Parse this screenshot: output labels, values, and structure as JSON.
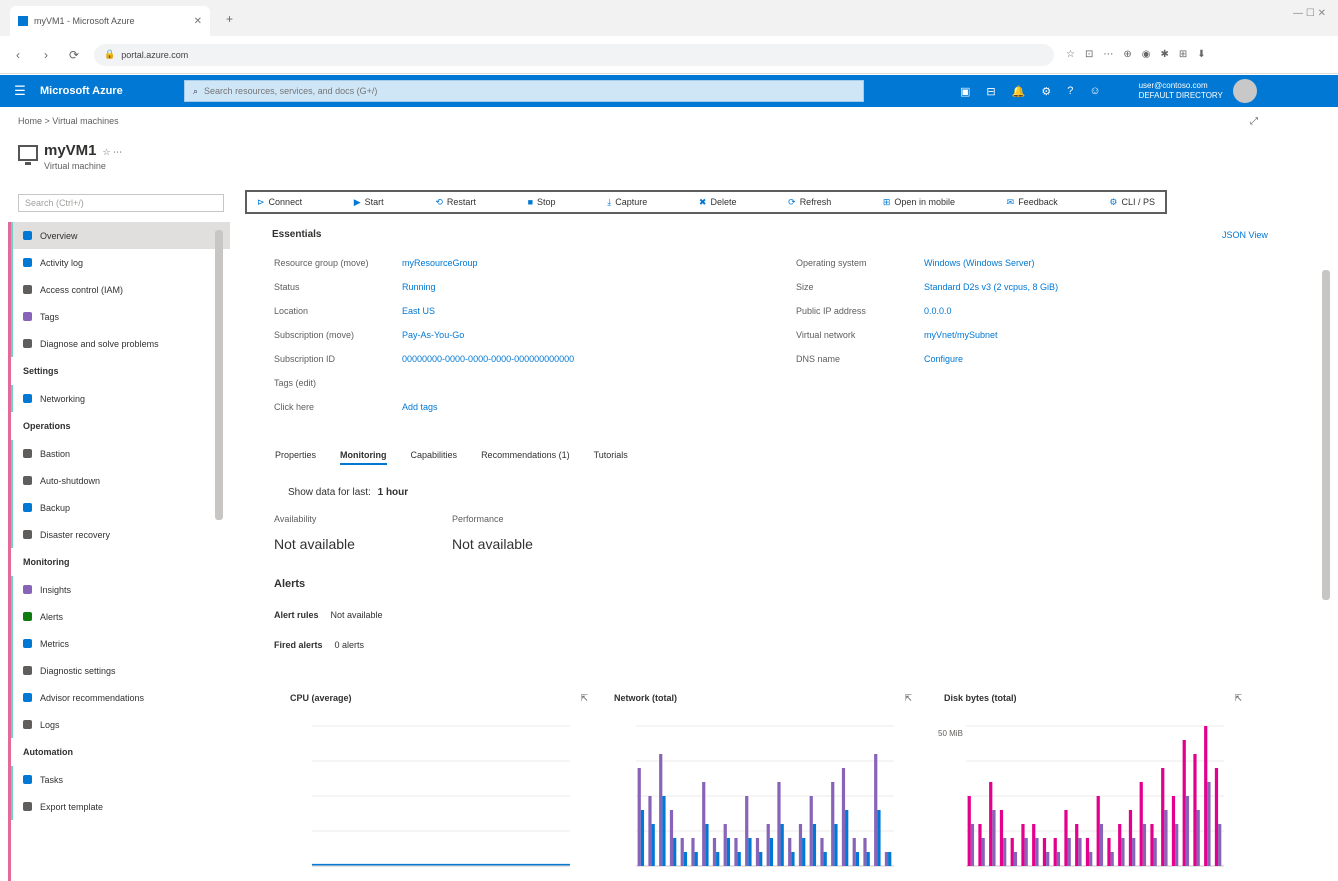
{
  "browser": {
    "tab_title": "myVM1 - Microsoft Azure",
    "address": "portal.azure.com",
    "new_tab": "+",
    "close": "✕",
    "window_controls": "—  ☐  ✕",
    "nav": {
      "back": "‹",
      "forward": "›",
      "reload": "⟳"
    },
    "extensions": [
      "☆",
      "⊡",
      "⋯",
      "⊕",
      "◉",
      "✱",
      "⊞",
      "⬇"
    ]
  },
  "portal": {
    "brand": "Microsoft Azure",
    "search_placeholder": "Search resources, services, and docs (G+/)",
    "header_icons": [
      "▣",
      "⊟",
      "🔔",
      "⚙",
      "?",
      "☺"
    ],
    "account_line1": "user@contoso.com",
    "account_line2": "DEFAULT DIRECTORY"
  },
  "blade": {
    "breadcrumb": "Home > Virtual machines",
    "title": "myVM1",
    "tag": "☆ ⋯",
    "subtitle": "Virtual machine",
    "close": "✕"
  },
  "menu": {
    "search_placeholder": "Search (Ctrl+/)",
    "items": [
      {
        "label": "Overview",
        "color": "#0078d4",
        "active": true
      },
      {
        "label": "Activity log",
        "color": "#0078d4"
      },
      {
        "label": "Access control (IAM)",
        "color": "#605e5c"
      },
      {
        "label": "Tags",
        "color": "#8764b8"
      },
      {
        "label": "Diagnose and solve problems",
        "color": "#605e5c"
      },
      {
        "section": "Settings"
      },
      {
        "label": "Networking",
        "color": "#0078d4"
      },
      {
        "section": "Operations"
      },
      {
        "label": "Bastion",
        "color": "#605e5c"
      },
      {
        "label": "Auto-shutdown",
        "color": "#605e5c"
      },
      {
        "label": "Backup",
        "color": "#0078d4"
      },
      {
        "label": "Disaster recovery",
        "color": "#605e5c"
      },
      {
        "section": "Monitoring"
      },
      {
        "label": "Insights",
        "color": "#8764b8"
      },
      {
        "label": "Alerts",
        "color": "#107c10"
      },
      {
        "label": "Metrics",
        "color": "#0078d4"
      },
      {
        "label": "Diagnostic settings",
        "color": "#605e5c"
      },
      {
        "label": "Advisor recommendations",
        "color": "#0078d4"
      },
      {
        "label": "Logs",
        "color": "#605e5c"
      },
      {
        "section": "Automation"
      },
      {
        "label": "Tasks",
        "color": "#0078d4"
      },
      {
        "label": "Export template",
        "color": "#605e5c"
      }
    ]
  },
  "commands": [
    {
      "glyph": "⊳",
      "label": "Connect"
    },
    {
      "glyph": "▶",
      "label": "Start"
    },
    {
      "glyph": "⟲",
      "label": "Restart"
    },
    {
      "glyph": "■",
      "label": "Stop"
    },
    {
      "glyph": "⤓",
      "label": "Capture"
    },
    {
      "glyph": "✖",
      "label": "Delete"
    },
    {
      "glyph": "⟳",
      "label": "Refresh"
    },
    {
      "glyph": "⊞",
      "label": "Open in mobile"
    },
    {
      "glyph": "✉",
      "label": "Feedback"
    },
    {
      "glyph": "⚙",
      "label": "CLI / PS"
    }
  ],
  "essentials": {
    "title": "Essentials",
    "json_view": "JSON View",
    "left": [
      {
        "label": "Resource group (move)",
        "value": "myResourceGroup"
      },
      {
        "label": "Status",
        "value": "Running"
      },
      {
        "label": "Location",
        "value": "East US"
      },
      {
        "label": "Subscription (move)",
        "value": "Pay-As-You-Go"
      },
      {
        "label": "Subscription ID",
        "value": "00000000-0000-0000-0000-000000000000"
      },
      {
        "label": "Tags (edit)",
        "value": ""
      },
      {
        "label": "Click here",
        "value": "Add tags"
      }
    ],
    "right": [
      {
        "label": "Operating system",
        "value": "Windows (Windows Server)"
      },
      {
        "label": "Size",
        "value": "Standard D2s v3 (2 vcpus, 8 GiB)"
      },
      {
        "label": "Public IP address",
        "value": "0.0.0.0"
      },
      {
        "label": "Virtual network",
        "value": "myVnet/mySubnet"
      },
      {
        "label": "DNS name",
        "value": "Configure"
      }
    ]
  },
  "tabs": [
    "Properties",
    "Monitoring",
    "Capabilities",
    "Recommendations (1)",
    "Tutorials"
  ],
  "monitoring": {
    "label": "Show data for last:",
    "value": "1 hour",
    "metrics": [
      {
        "label": "Availability",
        "value": "Not available"
      },
      {
        "label": "Performance",
        "value": "Not available"
      }
    ],
    "alerts_title": "Alerts",
    "alert_rows": [
      {
        "label": "Alert rules",
        "value": "Not available"
      },
      {
        "label": "Fired alerts",
        "value": "0 alerts"
      }
    ]
  },
  "charts": [
    {
      "title": "CPU (average)",
      "pin": "⇱"
    },
    {
      "title": "Network (total)",
      "pin": "⇱"
    },
    {
      "title": "Disk bytes (total)",
      "pin": "⇱",
      "ylabel": "50 MiB"
    }
  ],
  "chart_data": [
    {
      "type": "line",
      "title": "CPU (average)",
      "x": [
        0,
        1,
        2,
        3,
        4,
        5,
        6,
        7,
        8,
        9,
        10,
        11
      ],
      "series": [
        {
          "values": [
            1,
            1,
            1,
            1,
            1,
            1,
            1,
            1,
            1,
            1,
            1,
            1
          ]
        }
      ],
      "ylim": [
        0,
        100
      ]
    },
    {
      "type": "bar",
      "title": "Network (total)",
      "x": [
        0,
        1,
        2,
        3,
        4,
        5,
        6,
        7,
        8,
        9,
        10,
        11,
        12,
        13,
        14,
        15,
        16,
        17,
        18,
        19,
        20,
        21,
        22,
        23
      ],
      "series": [
        {
          "color": "#8764b8",
          "values": [
            0.7,
            0.5,
            0.8,
            0.4,
            0.2,
            0.2,
            0.6,
            0.2,
            0.3,
            0.2,
            0.5,
            0.2,
            0.3,
            0.6,
            0.2,
            0.3,
            0.5,
            0.2,
            0.6,
            0.7,
            0.2,
            0.2,
            0.8,
            0.1
          ]
        },
        {
          "color": "#0078d4",
          "values": [
            0.4,
            0.3,
            0.5,
            0.2,
            0.1,
            0.1,
            0.3,
            0.1,
            0.2,
            0.1,
            0.2,
            0.1,
            0.2,
            0.3,
            0.1,
            0.2,
            0.3,
            0.1,
            0.3,
            0.4,
            0.1,
            0.1,
            0.4,
            0.1
          ]
        }
      ],
      "ylim": [
        0,
        1
      ]
    },
    {
      "type": "bar",
      "title": "Disk bytes (total)",
      "x": [
        0,
        1,
        2,
        3,
        4,
        5,
        6,
        7,
        8,
        9,
        10,
        11,
        12,
        13,
        14,
        15,
        16,
        17,
        18,
        19,
        20,
        21,
        22,
        23
      ],
      "series": [
        {
          "color": "#e3008c",
          "values": [
            0.5,
            0.3,
            0.6,
            0.4,
            0.2,
            0.3,
            0.3,
            0.2,
            0.2,
            0.4,
            0.3,
            0.2,
            0.5,
            0.2,
            0.3,
            0.4,
            0.6,
            0.3,
            0.7,
            0.5,
            0.9,
            0.8,
            1.0,
            0.7
          ]
        },
        {
          "color": "#8764b8",
          "values": [
            0.3,
            0.2,
            0.4,
            0.2,
            0.1,
            0.2,
            0.2,
            0.1,
            0.1,
            0.2,
            0.2,
            0.1,
            0.3,
            0.1,
            0.2,
            0.2,
            0.3,
            0.2,
            0.4,
            0.3,
            0.5,
            0.4,
            0.6,
            0.3
          ]
        }
      ],
      "ylim": [
        0,
        1
      ]
    }
  ]
}
